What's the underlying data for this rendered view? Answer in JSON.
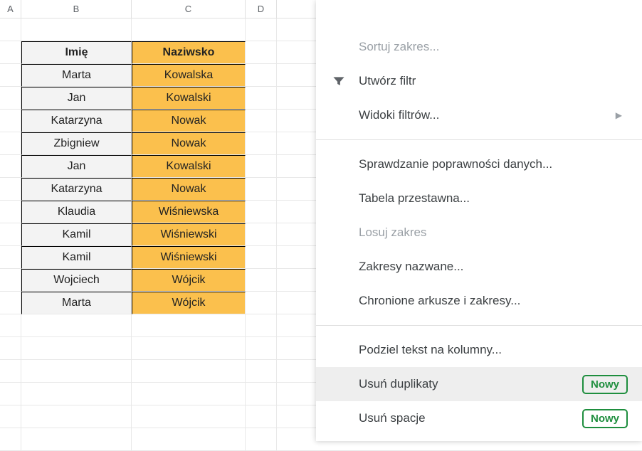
{
  "columns": [
    "A",
    "B",
    "C",
    "D"
  ],
  "table": {
    "headers": [
      "Imię",
      "Naziwsko"
    ],
    "rows": [
      [
        "Marta",
        "Kowalska"
      ],
      [
        "Jan",
        "Kowalski"
      ],
      [
        "Katarzyna",
        "Nowak"
      ],
      [
        "Zbigniew",
        "Nowak"
      ],
      [
        "Jan",
        "Kowalski"
      ],
      [
        "Katarzyna",
        "Nowak"
      ],
      [
        "Klaudia",
        "Wiśniewska"
      ],
      [
        "Kamil",
        "Wiśniewski"
      ],
      [
        "Kamil",
        "Wiśniewski"
      ],
      [
        "Wojciech",
        "Wójcik"
      ],
      [
        "Marta",
        "Wójcik"
      ]
    ]
  },
  "menu": {
    "sort_range": "Sortuj zakres...",
    "create_filter": "Utwórz filtr",
    "filter_views": "Widoki filtrów...",
    "data_validation": "Sprawdzanie poprawności danych...",
    "pivot_table": "Tabela przestawna...",
    "randomize_range": "Losuj zakres",
    "named_ranges": "Zakresy nazwane...",
    "protected_sheets": "Chronione arkusze i zakresy...",
    "split_text": "Podziel tekst na kolumny...",
    "remove_duplicates": "Usuń duplikaty",
    "trim_whitespace": "Usuń spacje",
    "badge_new": "Nowy"
  }
}
